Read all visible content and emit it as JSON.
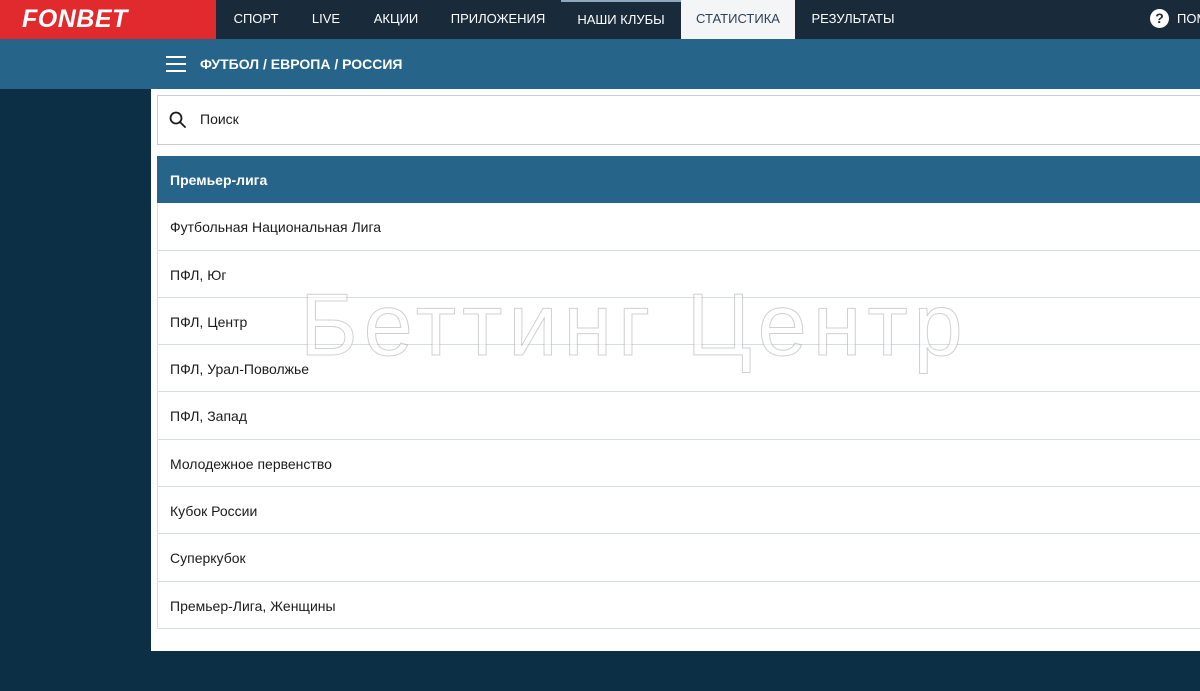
{
  "header": {
    "logo": "FONBET",
    "nav": [
      {
        "label": "СПОРТ"
      },
      {
        "label": "LIVE"
      },
      {
        "label": "АКЦИИ"
      },
      {
        "label": "ПРИЛОЖЕНИЯ"
      },
      {
        "label": "НАШИ КЛУБЫ"
      },
      {
        "label": "СТАТИСТИКА"
      },
      {
        "label": "РЕЗУЛЬТАТЫ"
      }
    ],
    "active_nav": "СТАТИСТИКА",
    "help": {
      "icon": "?",
      "label": "ПОМ"
    }
  },
  "breadcrumb": {
    "text": "ФУТБОЛ / ЕВРОПА / РОССИЯ"
  },
  "search": {
    "placeholder": "Поиск",
    "value": ""
  },
  "leagues": [
    {
      "label": "Премьер-лига",
      "selected": true
    },
    {
      "label": "Футбольная Национальная Лига"
    },
    {
      "label": "ПФЛ, Юг"
    },
    {
      "label": "ПФЛ, Центр"
    },
    {
      "label": "ПФЛ, Урал-Поволжье"
    },
    {
      "label": "ПФЛ, Запад"
    },
    {
      "label": "Молодежное первенство"
    },
    {
      "label": "Кубок России"
    },
    {
      "label": "Суперкубок"
    },
    {
      "label": "Премьер-Лига, Женщины"
    }
  ],
  "watermark": "Беттинг Центр",
  "colors": {
    "brand_red": "#e02a2d",
    "nav_bg": "#192a3a",
    "accent_blue": "#27648a",
    "page_bg": "#0c2f45"
  }
}
